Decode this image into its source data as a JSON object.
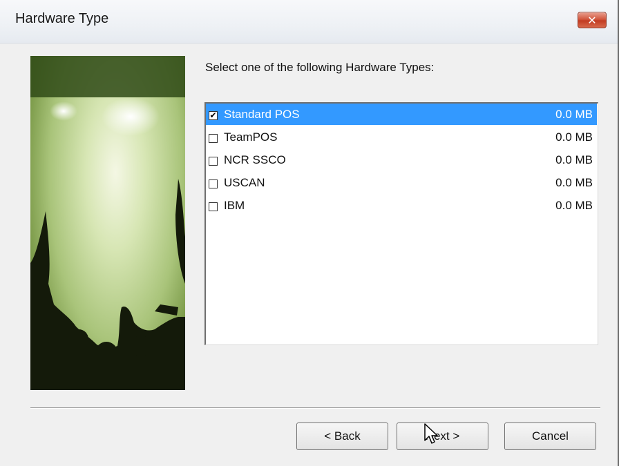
{
  "window": {
    "title": "Hardware Type",
    "close_glyph": "✕"
  },
  "main": {
    "prompt": "Select one of the following Hardware Types:"
  },
  "hardware_list": [
    {
      "label": "Standard POS",
      "size": "0.0 MB",
      "checked": true,
      "selected": true
    },
    {
      "label": "TeamPOS",
      "size": "0.0 MB",
      "checked": false,
      "selected": false
    },
    {
      "label": "NCR SSCO",
      "size": "0.0 MB",
      "checked": false,
      "selected": false
    },
    {
      "label": "USCAN",
      "size": "0.0 MB",
      "checked": false,
      "selected": false
    },
    {
      "label": "IBM",
      "size": "0.0 MB",
      "checked": false,
      "selected": false
    }
  ],
  "buttons": {
    "back": "< Back",
    "next": "Next >",
    "cancel": "Cancel"
  },
  "colors": {
    "selection": "#3399ff",
    "close_button": "#c23c22"
  },
  "icons": {
    "close": "close-icon",
    "checkmark": "checkmark-icon",
    "cursor": "mouse-pointer-icon"
  }
}
